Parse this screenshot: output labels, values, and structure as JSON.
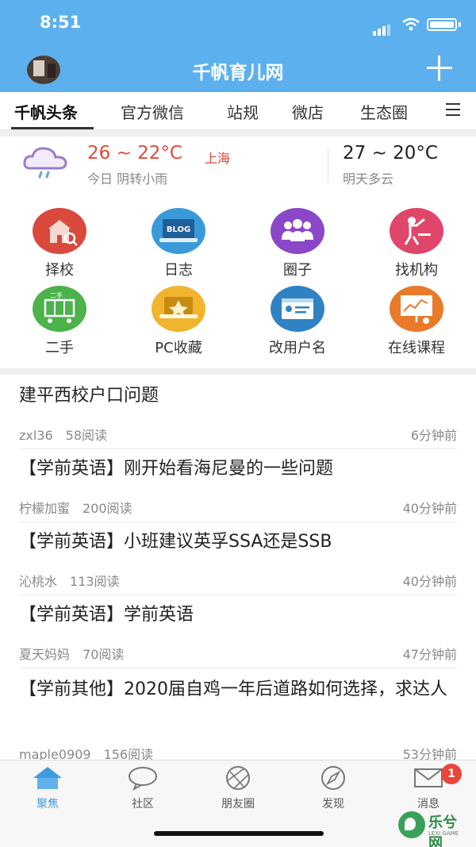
{
  "status_bar": {
    "time": "8:51"
  },
  "header": {
    "title": "千帆育儿网"
  },
  "tabs": [
    {
      "label": "千帆头条",
      "active": true
    },
    {
      "label": "官方微信"
    },
    {
      "label": "站规"
    },
    {
      "label": "微店"
    },
    {
      "label": "生态圈"
    }
  ],
  "weather": {
    "today_temp": "26 ~ 22°C",
    "city": "上海",
    "today_desc": "今日 阴转小雨",
    "tomorrow_temp": "27 ~ 20°C",
    "tomorrow_desc": "明天多云"
  },
  "grid": [
    {
      "label": "择校",
      "icon": "school-icon",
      "color": "#d94a3c",
      "text": ""
    },
    {
      "label": "日志",
      "icon": "blog-icon",
      "color": "#3a9ad9",
      "text": "BLOG"
    },
    {
      "label": "圈子",
      "icon": "group-icon",
      "color": "#8a47c8",
      "text": ""
    },
    {
      "label": "找机构",
      "icon": "teacher-icon",
      "color": "#e0466a",
      "text": ""
    },
    {
      "label": "二手",
      "icon": "cart-icon",
      "color": "#4cb24a",
      "text": "二手"
    },
    {
      "label": "PC收藏",
      "icon": "laptop-icon",
      "color": "#f0b42e",
      "text": ""
    },
    {
      "label": "改用户名",
      "icon": "id-card-icon",
      "color": "#2f83c4",
      "text": ""
    },
    {
      "label": "在线课程",
      "icon": "presentation-icon",
      "color": "#e87a2a",
      "text": ""
    }
  ],
  "articles": [
    {
      "title": "建平西校户口问题",
      "author": "zxl36",
      "reads": "58阅读",
      "time": "6分钟前"
    },
    {
      "title": "【学前英语】刚开始看海尼曼的一些问题",
      "author": "柠檬加蜜",
      "reads": "200阅读",
      "time": "40分钟前"
    },
    {
      "title": "【学前英语】小班建议英孚SSA还是SSB",
      "author": "沁桃水",
      "reads": "113阅读",
      "time": "40分钟前"
    },
    {
      "title": "【学前英语】学前英语",
      "author": "夏天妈妈",
      "reads": "70阅读",
      "time": "47分钟前"
    },
    {
      "title": "【学前其他】2020届自鸡一年后道路如何选择，求达人",
      "author": "maple0909",
      "reads": "156阅读",
      "time": "53分钟前"
    }
  ],
  "bottom_nav": [
    {
      "label": "聚焦",
      "icon": "home-icon",
      "active": true
    },
    {
      "label": "社区",
      "icon": "chat-bubble-icon"
    },
    {
      "label": "朋友圈",
      "icon": "aperture-icon"
    },
    {
      "label": "发现",
      "icon": "compass-icon"
    },
    {
      "label": "消息",
      "icon": "envelope-icon",
      "badge": "1"
    }
  ],
  "watermark": {
    "name": "乐兮网",
    "sub": "LEXI GAME"
  }
}
